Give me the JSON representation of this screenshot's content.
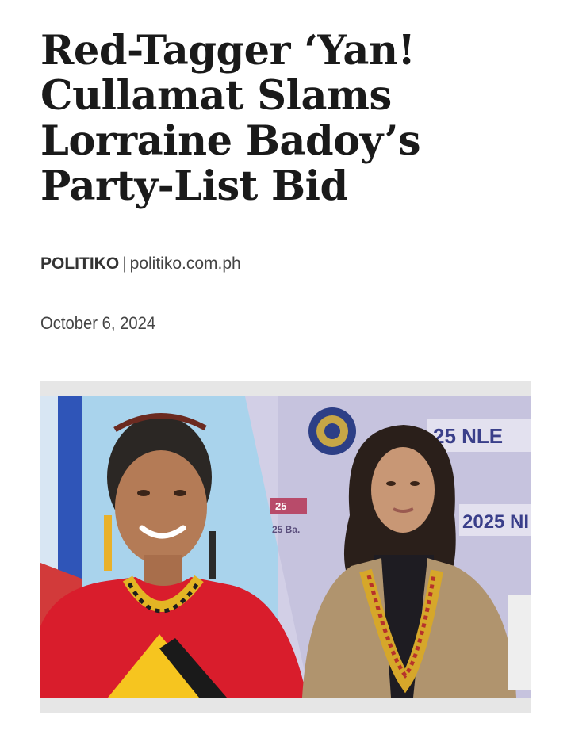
{
  "article": {
    "headline_lines": [
      "Red-Tagger ‘Yan!",
      "Cullamat Slams",
      "Lorraine Badoy’s",
      "Party-List Bid"
    ],
    "source": "POLITIKO",
    "separator": "|",
    "source_url": "politiko.com.ph",
    "date": "October 6, 2024"
  },
  "photo": {
    "sign_texts": [
      "25 NLE",
      "2025 NI",
      "25",
      "25 Ba."
    ],
    "colors": {
      "left_bg_light": "#a9d3ec",
      "right_bg": "#c6c3de",
      "dress_red": "#d91d2c",
      "jacket_tan": "#b0946e",
      "flag_blue": "#2f55b8"
    }
  }
}
